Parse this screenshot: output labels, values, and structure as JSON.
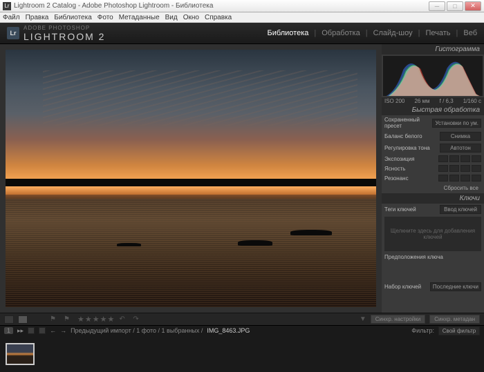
{
  "titlebar": {
    "text": "Lightroom 2 Catalog - Adobe Photoshop Lightroom - Библиотека",
    "logo": "Lr"
  },
  "menubar": [
    "Файл",
    "Правка",
    "Библиотека",
    "Фото",
    "Метаданные",
    "Вид",
    "Окно",
    "Справка"
  ],
  "header": {
    "tagline": "ADOBE PHOTOSHOP",
    "appname": "LIGHTROOM 2",
    "logo": "Lr"
  },
  "modules": [
    {
      "label": "Библиотека",
      "active": true
    },
    {
      "label": "Обработка",
      "active": false
    },
    {
      "label": "Слайд-шоу",
      "active": false
    },
    {
      "label": "Печать",
      "active": false
    },
    {
      "label": "Веб",
      "active": false
    }
  ],
  "histogram": {
    "title": "Гистограмма",
    "iso": "ISO 200",
    "focal": "26 мм",
    "aperture": "f / 6,3",
    "shutter": "1/160 с"
  },
  "quickdev": {
    "title": "Быстрая обработка",
    "preset_label": "Сохраненный пресет",
    "preset_val": "Установки по ум.",
    "wb_label": "Баланс белого",
    "wb_val": "Снимка",
    "tone_label": "Регулировка тона",
    "tone_btn": "Автотон",
    "exposure": "Экспозиция",
    "clarity": "Ясность",
    "vibrance": "Резонанс",
    "reset": "Сбросить все"
  },
  "keywords": {
    "title": "Ключи",
    "tags_label": "Теги ключей",
    "tags_val": "Ввод ключей",
    "placeholder": "Щелкните здесь для добавления ключей",
    "suggest": "Предположения ключа",
    "set_label": "Набор ключей",
    "set_val": "Последние ключи"
  },
  "sync": {
    "settings": "Синхр. настройки",
    "metadata": "Синхр. метадан"
  },
  "filmstrip": {
    "badge": "1",
    "nav": "▸▸",
    "info": "Предыдущий импорт / 1 фото / 1 выбранных /",
    "filename": "IMG_8463.JPG",
    "filter_label": "Фильтр:",
    "filter_val": "Свой фильтр"
  }
}
